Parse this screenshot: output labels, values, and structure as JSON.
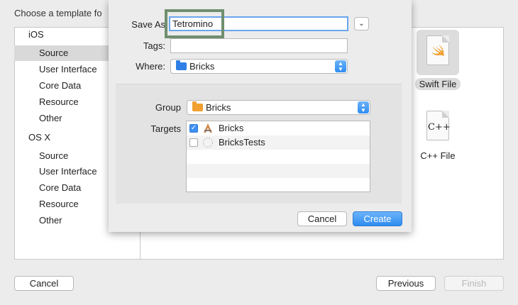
{
  "background": {
    "title": "Choose a template fo",
    "sidebar": {
      "sections": [
        {
          "heading": "iOS",
          "items": [
            "Source",
            "User Interface",
            "Core Data",
            "Resource",
            "Other"
          ]
        },
        {
          "heading": "OS X",
          "items": [
            "Source",
            "User Interface",
            "Core Data",
            "Resource",
            "Other"
          ]
        }
      ],
      "selected": "Source"
    },
    "templates": [
      {
        "label": "Swift File",
        "icon": "swift-file-icon",
        "selected": true
      },
      {
        "label": "C++ File",
        "icon": "cpp-file-icon",
        "icon_text": "C++",
        "selected": false
      }
    ],
    "buttons": {
      "cancel": "Cancel",
      "previous": "Previous",
      "finish": "Finish"
    }
  },
  "sheet": {
    "save_as_label": "Save As",
    "save_as_value": "Tetromino",
    "tags_label": "Tags:",
    "tags_value": "",
    "where_label": "Where:",
    "where_value": "Bricks",
    "group_label": "Group",
    "group_value": "Bricks",
    "targets_label": "Targets",
    "targets": [
      {
        "name": "Bricks",
        "checked": true,
        "icon": "app-target-icon"
      },
      {
        "name": "BricksTests",
        "checked": false,
        "icon": "test-target-icon"
      }
    ],
    "buttons": {
      "cancel": "Cancel",
      "create": "Create"
    }
  },
  "colors": {
    "accent": "#2e8cf0",
    "highlight_box": "#6f8f6f",
    "folder_blue": "#2f7fe6",
    "folder_orange": "#f0a030"
  }
}
